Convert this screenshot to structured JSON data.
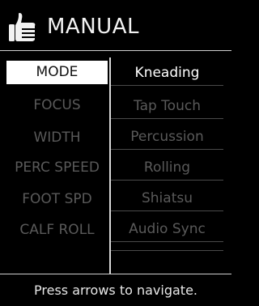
{
  "header": {
    "title": "MANUAL",
    "icon": "thumbs-up-icon"
  },
  "left_menu": {
    "selected_index": 0,
    "items": [
      "MODE",
      "FOCUS",
      "WIDTH",
      "PERC SPEED",
      "FOOT SPD",
      "CALF ROLL"
    ]
  },
  "right_menu": {
    "selected_index": 0,
    "items": [
      "Kneading",
      "Tap Touch",
      "Percussion",
      "Rolling",
      "Shiatsu",
      "Audio Sync"
    ]
  },
  "footer": {
    "hint": "Press arrows to navigate."
  },
  "colors": {
    "background": "#000000",
    "selected_bg": "#ffffff",
    "dim_text": "#5a5a5a",
    "bright_text": "#ffffff"
  }
}
